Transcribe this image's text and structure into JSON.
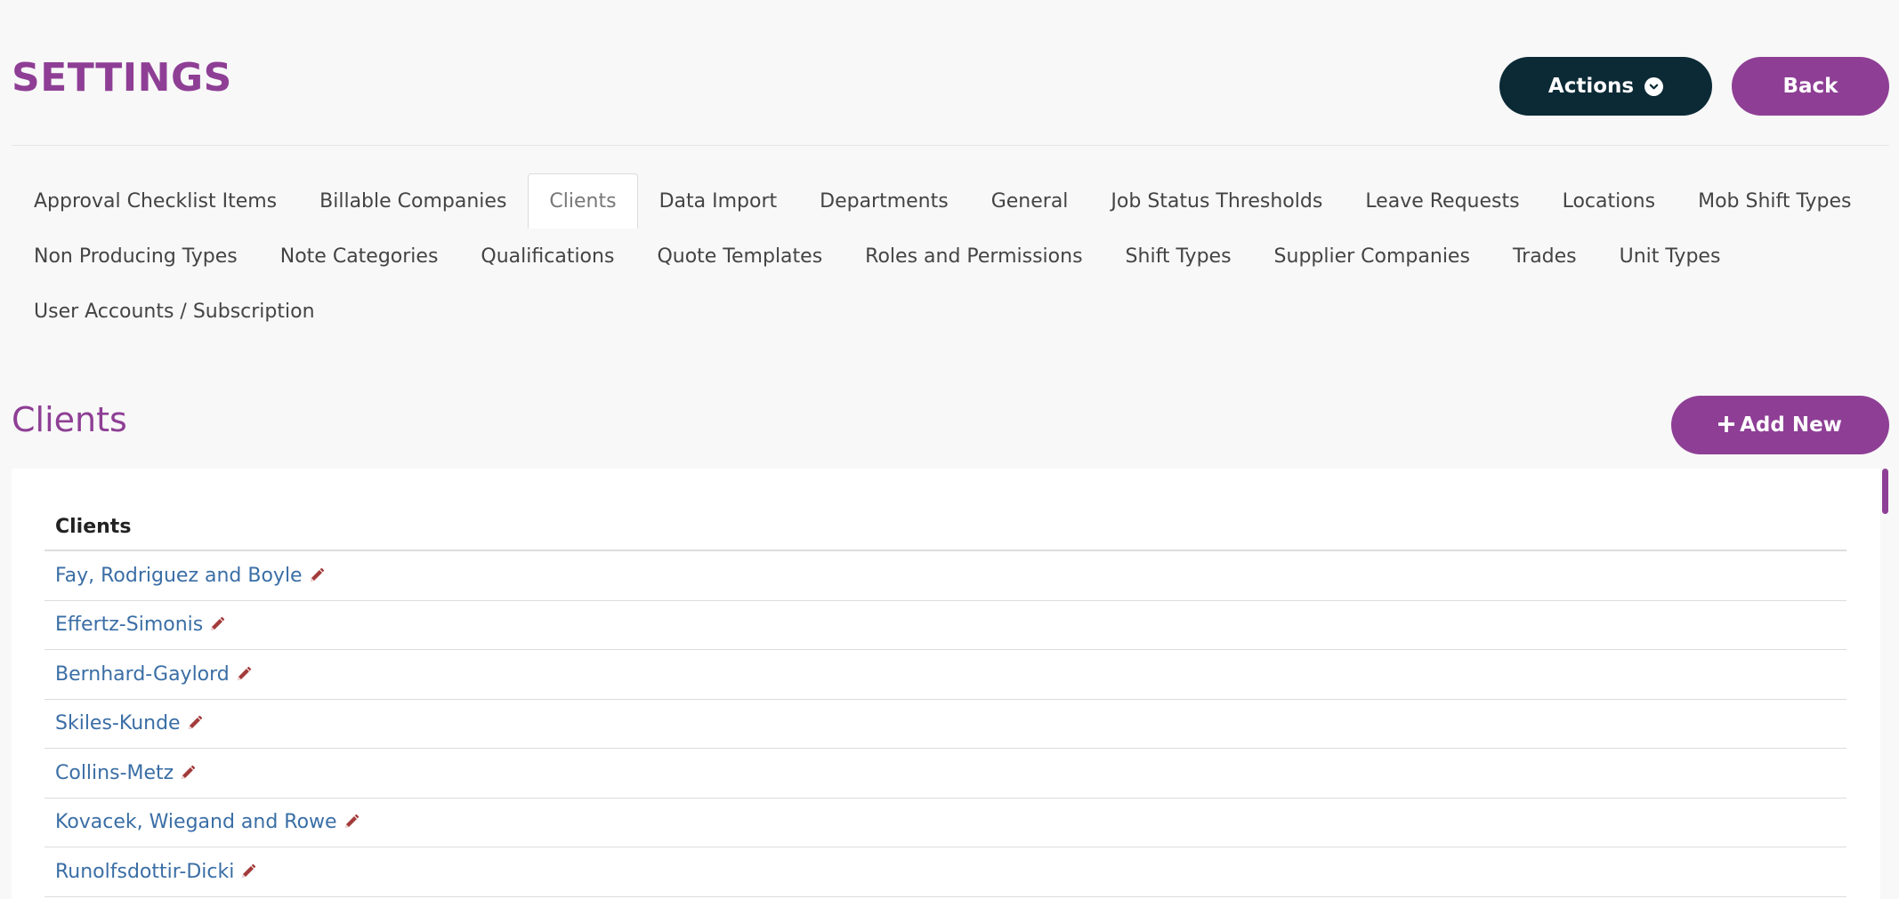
{
  "header": {
    "title": "SETTINGS",
    "actions_label": "Actions",
    "back_label": "Back"
  },
  "tabs": {
    "row1": [
      "Approval Checklist Items",
      "Billable Companies",
      "Clients",
      "Data Import",
      "Departments",
      "General",
      "Job Status Thresholds",
      "Leave Requests",
      "Locations",
      "Mob Shift Types"
    ],
    "row2": [
      "Non Producing Types",
      "Note Categories",
      "Qualifications",
      "Quote Templates",
      "Roles and Permissions",
      "Shift Types",
      "Supplier Companies",
      "Trades",
      "Unit Types"
    ],
    "row3": [
      "User Accounts / Subscription"
    ],
    "active": "Clients"
  },
  "section": {
    "title": "Clients",
    "add_label": "Add New",
    "add_icon": "plus-icon"
  },
  "table": {
    "header": "Clients",
    "rows": [
      "Fay, Rodriguez and Boyle",
      "Effertz-Simonis",
      "Bernhard-Gaylord",
      "Skiles-Kunde",
      "Collins-Metz",
      "Kovacek, Wiegand and Rowe",
      "Runolfsdottir-Dicki"
    ],
    "row_icon": "pencil-icon"
  },
  "colors": {
    "brand_purple": "#8e3f95",
    "dark_button": "#0b2a36",
    "link_blue": "#3a6ea5",
    "edit_red": "#a33b3b"
  }
}
